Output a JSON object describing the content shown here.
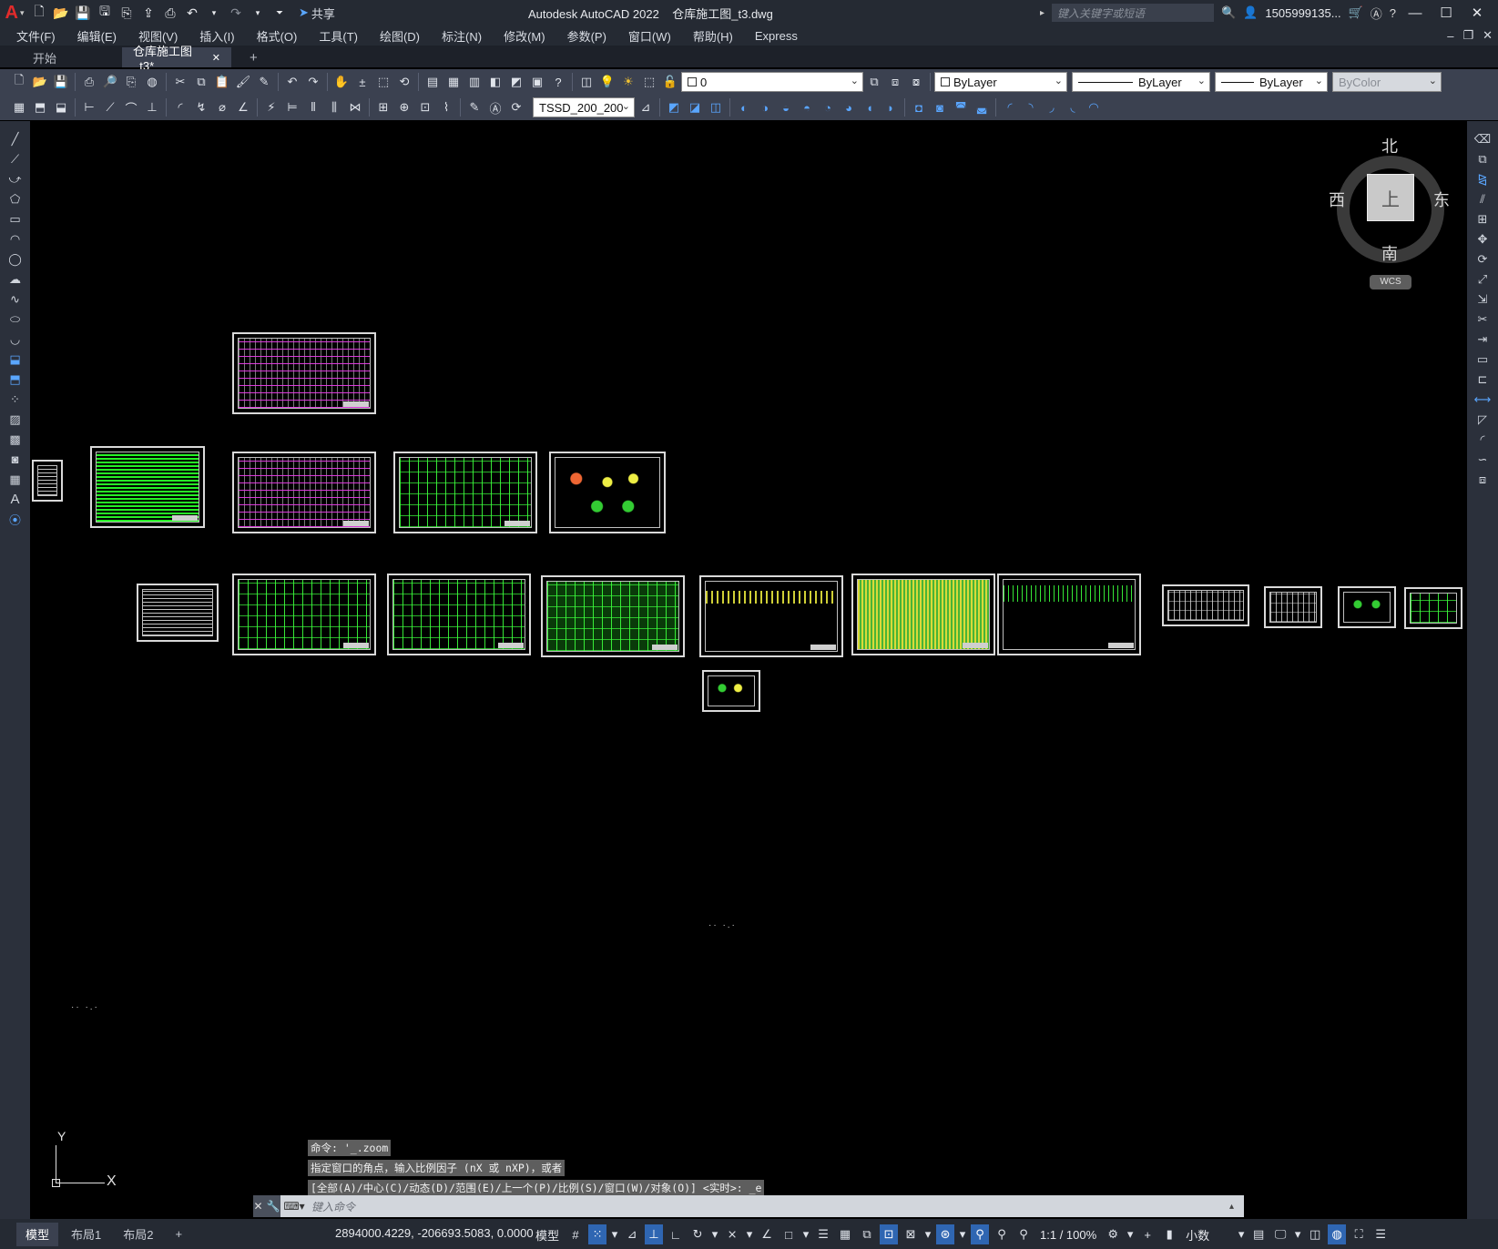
{
  "app": {
    "title": "Autodesk AutoCAD 2022    仓库施工图_t3.dwg",
    "logo": "A",
    "share_label": "共享",
    "search_placeholder": "键入关键字或短语",
    "user": "1505999135...",
    "colors": {
      "chrome": "#252a33",
      "toolbar": "#3b4150",
      "canvas": "#000000",
      "accent": "#2f66b2"
    }
  },
  "menu": [
    "文件(F)",
    "编辑(E)",
    "视图(V)",
    "插入(I)",
    "格式(O)",
    "工具(T)",
    "绘图(D)",
    "标注(N)",
    "修改(M)",
    "参数(P)",
    "窗口(W)",
    "帮助(H)",
    "Express"
  ],
  "tabs": {
    "start": "开始",
    "active": "仓库施工图_t3*",
    "close": "✕",
    "add": "+"
  },
  "toolbar": {
    "layer_value": "0",
    "color_value": "ByLayer",
    "linetype_value": "ByLayer",
    "lineweight_value": "ByLayer",
    "plotstyle_value": "ByColor",
    "dimstyle_value": "TSSD_200_200"
  },
  "viewcube": {
    "north": "北",
    "south": "南",
    "east": "东",
    "west": "西",
    "top": "上",
    "wcs": "WCS"
  },
  "ucs": {
    "x": "X",
    "y": "Y"
  },
  "command": {
    "history": [
      "命令: '_.zoom",
      "指定窗口的角点，输入比例因子 (nX 或 nXP)，或者",
      "[全部(A)/中心(C)/动态(D)/范围(E)/上一个(P)/比例(S)/窗口(W)/对象(O)] <实时>: _e"
    ],
    "placeholder": "键入命令"
  },
  "status": {
    "layouts": [
      "模型",
      "布局1",
      "布局2"
    ],
    "add_layout": "+",
    "coordinates": "2894000.4229, -206693.5083, 0.0000",
    "model_label": "模型",
    "scale": "1:1 / 100%",
    "units": "小数"
  }
}
